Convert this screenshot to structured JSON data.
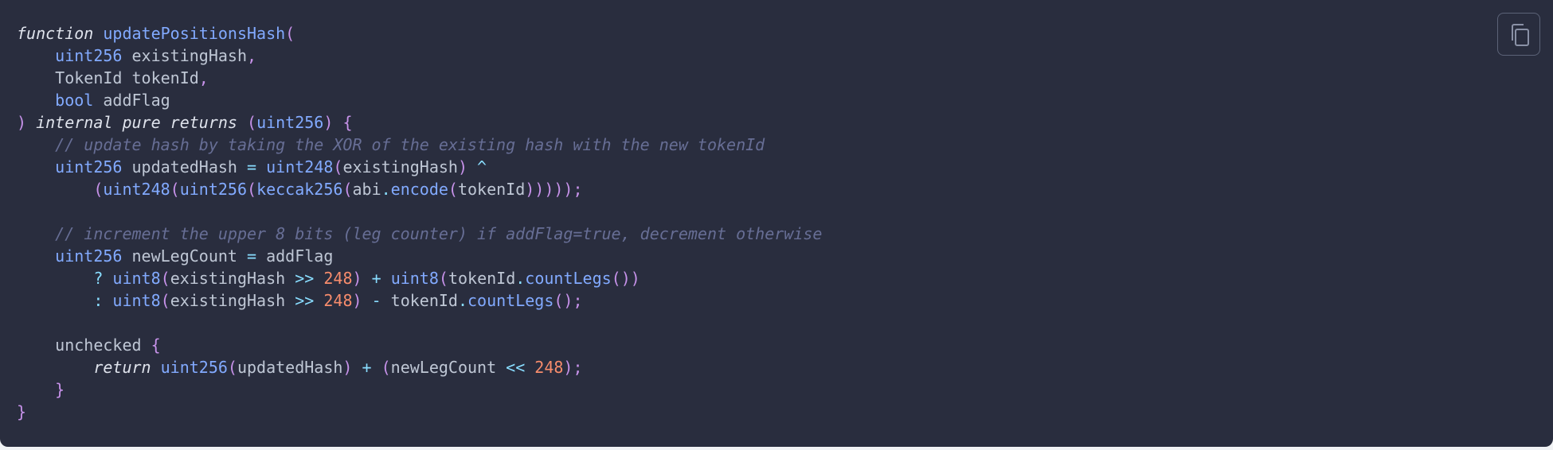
{
  "copy_button": {
    "icon": "copy-icon"
  },
  "code": {
    "language": "solidity",
    "lines": [
      [
        [
          "kw-it",
          "function"
        ],
        [
          "plain",
          " "
        ],
        [
          "fn",
          "updatePositionsHash"
        ],
        [
          "punc",
          "("
        ]
      ],
      [
        [
          "plain",
          "    "
        ],
        [
          "type",
          "uint256"
        ],
        [
          "plain",
          " existingHash"
        ],
        [
          "punc",
          ","
        ]
      ],
      [
        [
          "plain",
          "    TokenId tokenId"
        ],
        [
          "punc",
          ","
        ]
      ],
      [
        [
          "plain",
          "    "
        ],
        [
          "type",
          "bool"
        ],
        [
          "plain",
          " addFlag"
        ]
      ],
      [
        [
          "punc",
          ")"
        ],
        [
          "plain",
          " "
        ],
        [
          "kw-it",
          "internal pure returns"
        ],
        [
          "plain",
          " "
        ],
        [
          "punc",
          "("
        ],
        [
          "type",
          "uint256"
        ],
        [
          "punc",
          ")"
        ],
        [
          "plain",
          " "
        ],
        [
          "punc",
          "{"
        ]
      ],
      [
        [
          "plain",
          "    "
        ],
        [
          "cmt",
          "// update hash by taking the XOR of the existing hash with the new tokenId"
        ]
      ],
      [
        [
          "plain",
          "    "
        ],
        [
          "type",
          "uint256"
        ],
        [
          "plain",
          " updatedHash "
        ],
        [
          "op",
          "="
        ],
        [
          "plain",
          " "
        ],
        [
          "type",
          "uint248"
        ],
        [
          "punc",
          "("
        ],
        [
          "plain",
          "existingHash"
        ],
        [
          "punc",
          ")"
        ],
        [
          "plain",
          " "
        ],
        [
          "op",
          "^"
        ]
      ],
      [
        [
          "plain",
          "        "
        ],
        [
          "punc",
          "("
        ],
        [
          "type",
          "uint248"
        ],
        [
          "punc",
          "("
        ],
        [
          "type",
          "uint256"
        ],
        [
          "punc",
          "("
        ],
        [
          "fn",
          "keccak256"
        ],
        [
          "punc",
          "("
        ],
        [
          "plain",
          "abi"
        ],
        [
          "op",
          "."
        ],
        [
          "fn",
          "encode"
        ],
        [
          "punc",
          "("
        ],
        [
          "plain",
          "tokenId"
        ],
        [
          "punc",
          ")))));"
        ]
      ],
      [],
      [
        [
          "plain",
          "    "
        ],
        [
          "cmt",
          "// increment the upper 8 bits (leg counter) if addFlag=true, decrement otherwise"
        ]
      ],
      [
        [
          "plain",
          "    "
        ],
        [
          "type",
          "uint256"
        ],
        [
          "plain",
          " newLegCount "
        ],
        [
          "op",
          "="
        ],
        [
          "plain",
          " addFlag"
        ]
      ],
      [
        [
          "plain",
          "        "
        ],
        [
          "op",
          "?"
        ],
        [
          "plain",
          " "
        ],
        [
          "type",
          "uint8"
        ],
        [
          "punc",
          "("
        ],
        [
          "plain",
          "existingHash "
        ],
        [
          "op",
          ">>"
        ],
        [
          "plain",
          " "
        ],
        [
          "num",
          "248"
        ],
        [
          "punc",
          ")"
        ],
        [
          "plain",
          " "
        ],
        [
          "op",
          "+"
        ],
        [
          "plain",
          " "
        ],
        [
          "type",
          "uint8"
        ],
        [
          "punc",
          "("
        ],
        [
          "plain",
          "tokenId"
        ],
        [
          "op",
          "."
        ],
        [
          "fn",
          "countLegs"
        ],
        [
          "punc",
          "())"
        ]
      ],
      [
        [
          "plain",
          "        "
        ],
        [
          "op",
          ":"
        ],
        [
          "plain",
          " "
        ],
        [
          "type",
          "uint8"
        ],
        [
          "punc",
          "("
        ],
        [
          "plain",
          "existingHash "
        ],
        [
          "op",
          ">>"
        ],
        [
          "plain",
          " "
        ],
        [
          "num",
          "248"
        ],
        [
          "punc",
          ")"
        ],
        [
          "plain",
          " "
        ],
        [
          "op",
          "-"
        ],
        [
          "plain",
          " tokenId"
        ],
        [
          "op",
          "."
        ],
        [
          "fn",
          "countLegs"
        ],
        [
          "punc",
          "();"
        ]
      ],
      [],
      [
        [
          "plain",
          "    unchecked "
        ],
        [
          "punc",
          "{"
        ]
      ],
      [
        [
          "plain",
          "        "
        ],
        [
          "kw-it",
          "return"
        ],
        [
          "plain",
          " "
        ],
        [
          "type",
          "uint256"
        ],
        [
          "punc",
          "("
        ],
        [
          "plain",
          "updatedHash"
        ],
        [
          "punc",
          ")"
        ],
        [
          "plain",
          " "
        ],
        [
          "op",
          "+"
        ],
        [
          "plain",
          " "
        ],
        [
          "punc",
          "("
        ],
        [
          "plain",
          "newLegCount "
        ],
        [
          "op",
          "<<"
        ],
        [
          "plain",
          " "
        ],
        [
          "num",
          "248"
        ],
        [
          "punc",
          ");"
        ]
      ],
      [
        [
          "plain",
          "    "
        ],
        [
          "punc",
          "}"
        ]
      ],
      [
        [
          "punc",
          "}"
        ]
      ]
    ]
  }
}
